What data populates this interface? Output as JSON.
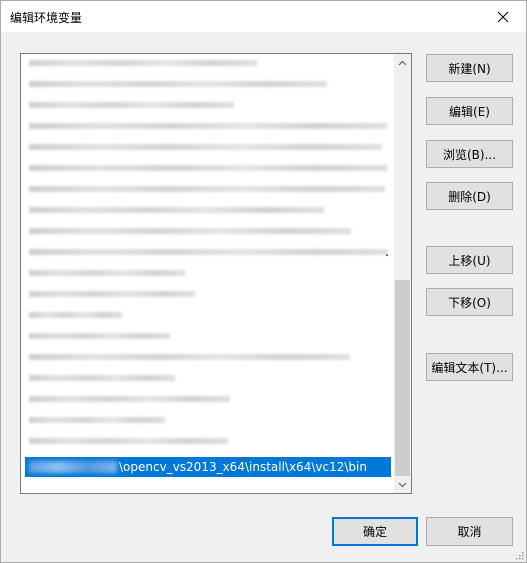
{
  "window": {
    "title": "编辑环境变量",
    "close_glyph": "✕"
  },
  "list": {
    "blurred_widths": [
      232,
      302,
      209,
      362,
      357,
      362,
      360,
      299,
      326,
      363,
      160,
      170,
      97,
      145,
      325,
      150,
      205,
      140,
      203
    ],
    "truncation_marker": ".",
    "selected_item_visible_text": "\\opencv_vs2013_x64\\install\\x64\\vc12\\bin"
  },
  "buttons": {
    "new": "新建(N)",
    "edit": "编辑(E)",
    "browse": "浏览(B)...",
    "delete": "删除(D)",
    "move_up": "上移(U)",
    "move_down": "下移(O)",
    "edit_text": "编辑文本(T)...",
    "ok": "确定",
    "cancel": "取消"
  },
  "scrollbar": {
    "up_glyph": "▲",
    "down_glyph": "▼"
  }
}
